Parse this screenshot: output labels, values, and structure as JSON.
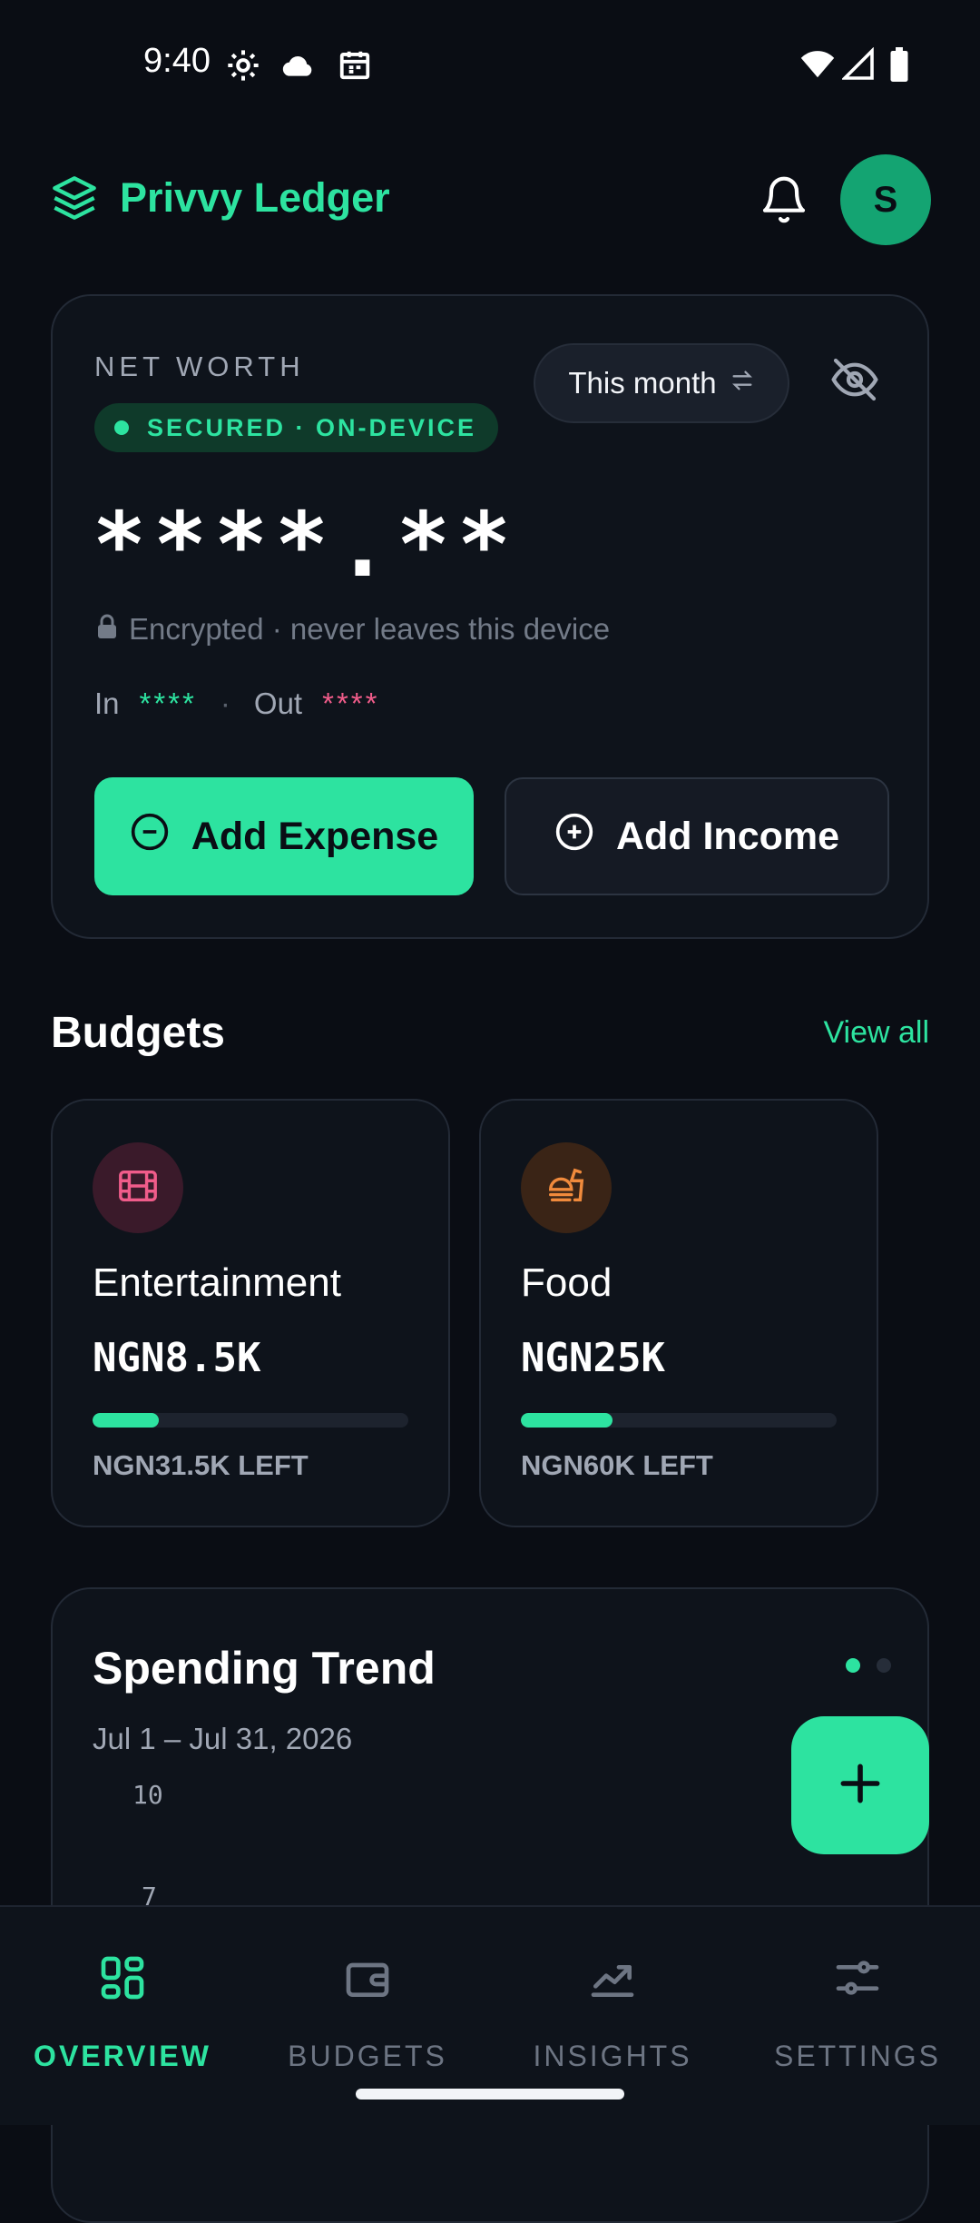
{
  "status_bar": {
    "time": "9:40",
    "icons": [
      "settings-gear-icon",
      "cloud-icon",
      "calendar-icon",
      "wifi-icon",
      "signal-icon",
      "battery-icon"
    ]
  },
  "header": {
    "app_title": "Privvy Ledger",
    "logo_icon": "layers-icon",
    "notification_icon": "bell-icon",
    "avatar_initial": "S"
  },
  "net_worth": {
    "label": "NET WORTH",
    "badge": "SECURED · ON-DEVICE",
    "period": "This month",
    "period_icon": "swap-arrows-icon",
    "visibility_icon": "eye-off-icon",
    "value": "****.**",
    "encrypted_note": "Encrypted · never leaves this device",
    "in_label": "In",
    "in_value": "****",
    "separator": "·",
    "out_label": "Out",
    "out_value": "****",
    "add_expense_label": "Add Expense",
    "add_income_label": "Add Income"
  },
  "budgets": {
    "title": "Budgets",
    "view_all": "View all",
    "items": [
      {
        "name": "Entertainment",
        "spent": "NGN8.5K",
        "left": "NGN31.5K LEFT",
        "progress": 0.21,
        "icon": "film-icon",
        "icon_color": "#f05c8a",
        "icon_bg": "#3a1a2a"
      },
      {
        "name": "Food",
        "spent": "NGN25K",
        "left": "NGN60K LEFT",
        "progress": 0.29,
        "icon": "fast-food-icon",
        "icon_color": "#f08a3c",
        "icon_bg": "#3a2416"
      }
    ]
  },
  "trend": {
    "title": "Spending Trend",
    "range": "Jul 1 – Jul 31, 2026",
    "y_ticks": [
      "10",
      "7"
    ]
  },
  "nav": {
    "items": [
      {
        "label": "OVERVIEW",
        "icon": "grid-icon",
        "active": true
      },
      {
        "label": "BUDGETS",
        "icon": "wallet-icon",
        "active": false
      },
      {
        "label": "INSIGHTS",
        "icon": "trend-up-icon",
        "active": false
      },
      {
        "label": "SETTINGS",
        "icon": "sliders-icon",
        "active": false
      }
    ]
  },
  "colors": {
    "accent": "#2de3a0",
    "background": "#0a0d14",
    "card": "#0e131b",
    "out_color": "#f05c8a"
  }
}
